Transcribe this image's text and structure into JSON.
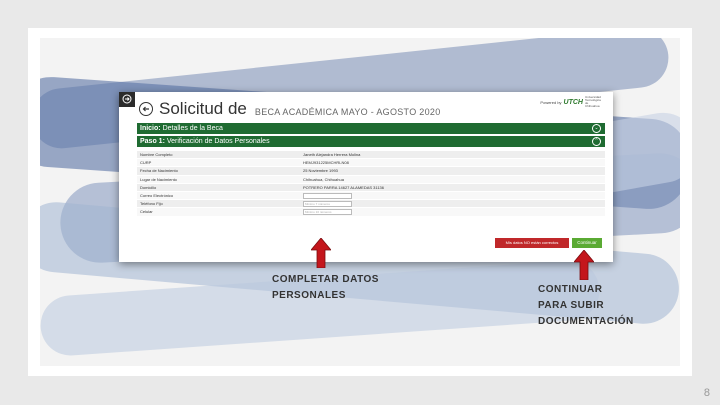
{
  "app": {
    "title": "Solicitud de",
    "subtitle": "BECA ACADÉMICA MAYO - AGOSTO 2020",
    "powered_by": "Powered by",
    "brand_logo": "UTCH",
    "brand_tagline": "Universidad Tecnológica de Chihuahua"
  },
  "sections": {
    "inicio_bold": "Inicio:",
    "inicio_text": " Detalles de la Beca",
    "paso_bold": "Paso 1:",
    "paso_text": " Verificación de Datos Personales"
  },
  "form_rows": [
    {
      "label": "Nombre Completo",
      "value": "Janeth Alejandra Herrera Molina"
    },
    {
      "label": "CURP",
      "value": "HEMJ931225MCHRLN08"
    },
    {
      "label": "Fecha de Nacimiento",
      "value": "25 Noviembre 1993"
    },
    {
      "label": "Lugar de Nacimiento",
      "value": "Chihuahua, Chihuahua"
    },
    {
      "label": "Domicilio",
      "value": "POTRERO PARRA 14627 ALAMEDAS 31136"
    },
    {
      "label": "Correo Electrónico",
      "value": ""
    },
    {
      "label": "Teléfono Fijo",
      "placeholder": "Mínimo 7 números"
    },
    {
      "label": "Celular",
      "placeholder": "Mínimo 10 números"
    }
  ],
  "buttons": {
    "incorrect": "Mis datos NO están correctos",
    "continue": "Continuar"
  },
  "captions": {
    "complete_line1": "COMPLETAR DATOS",
    "complete_line2": "PERSONALES",
    "continue_line1": "CONTINUAR",
    "continue_line2": "PARA SUBIR",
    "continue_line3": "DOCUMENTACIÓN"
  },
  "page_number": "8",
  "colors": {
    "section_bar": "#1f6b32",
    "button_red": "#c0282a",
    "button_green": "#5aaa33",
    "arrow_red": "#c4161c"
  }
}
